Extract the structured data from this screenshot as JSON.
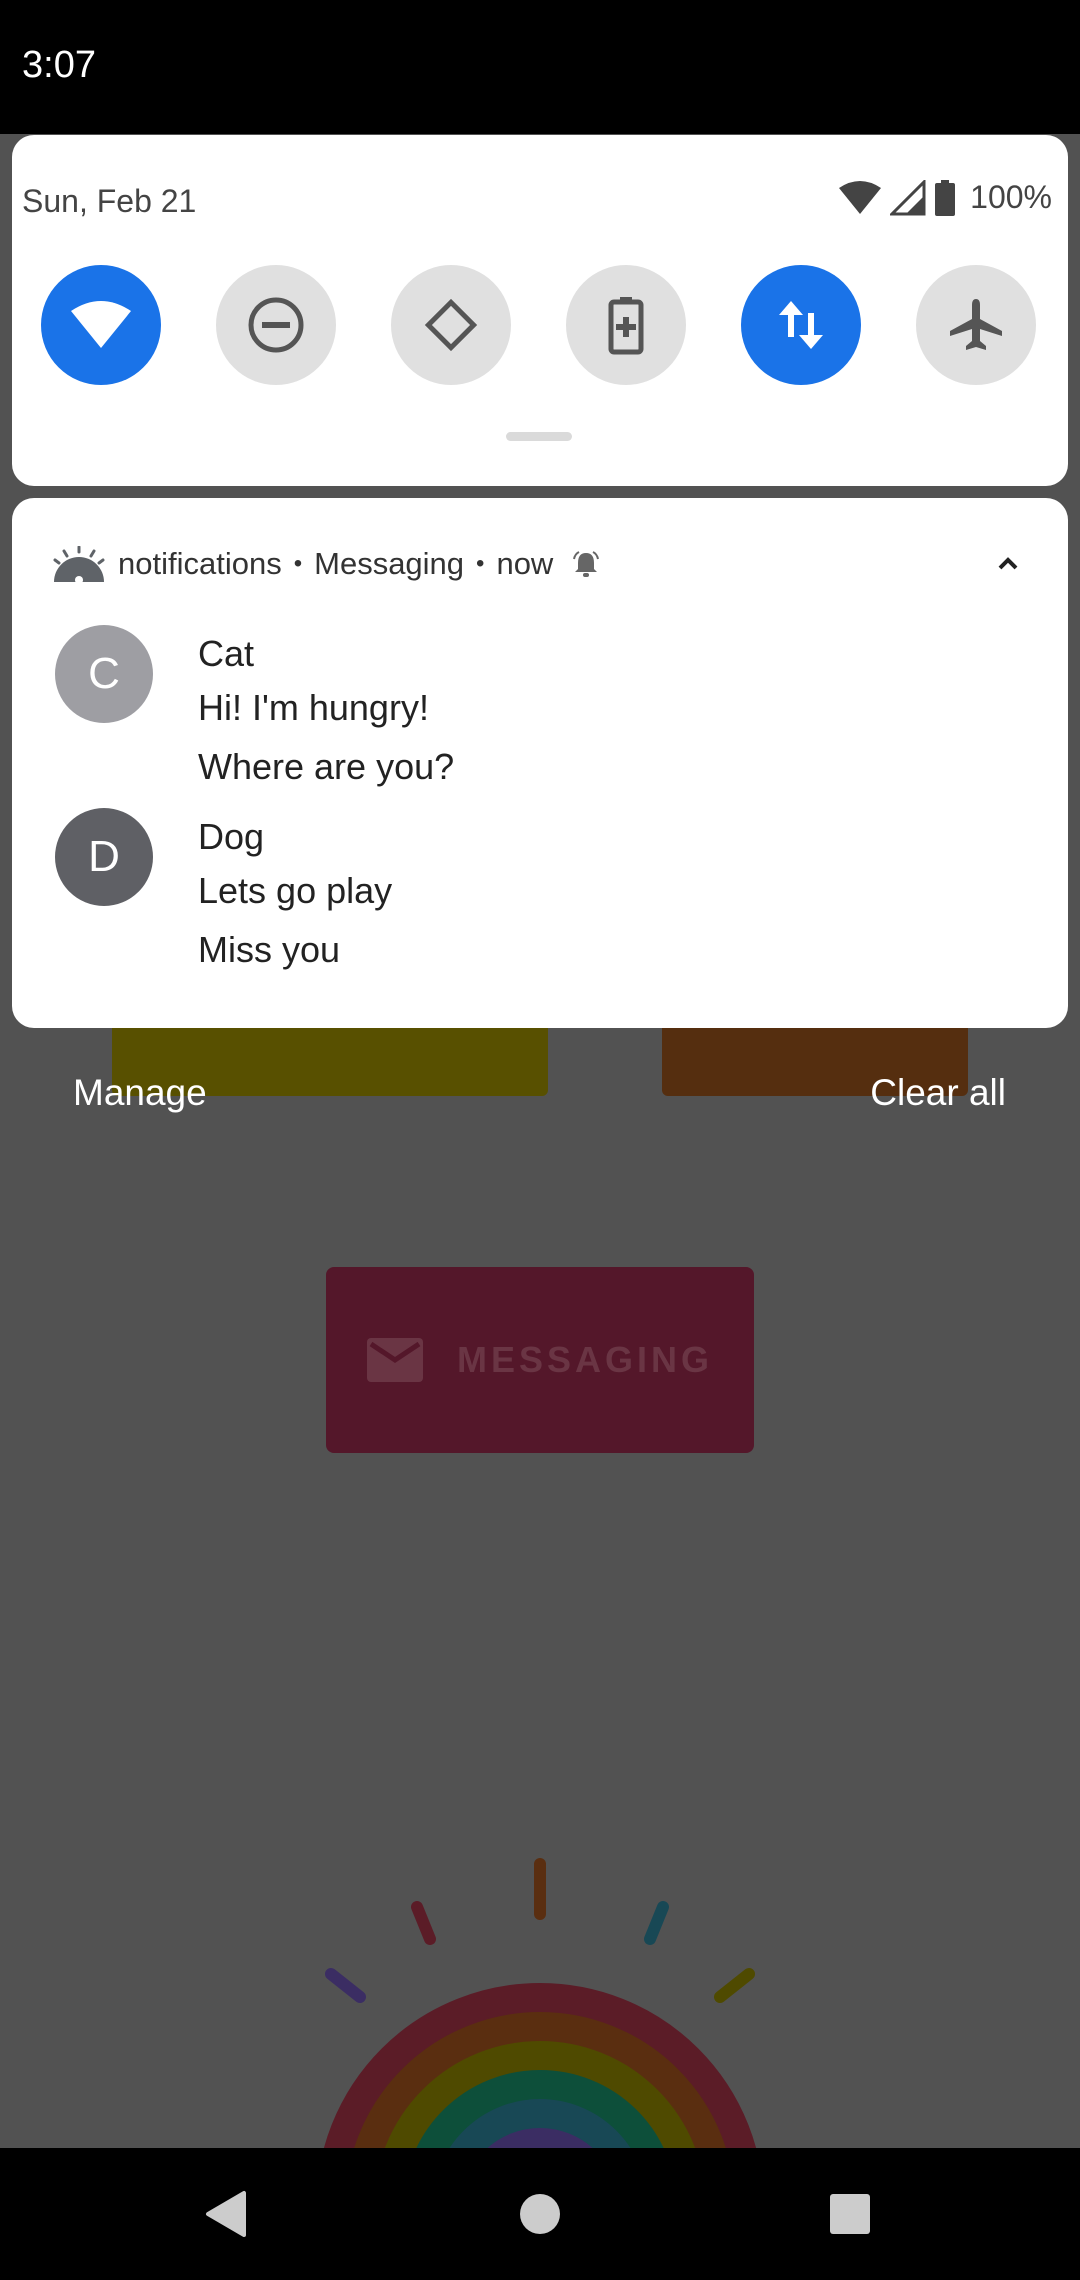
{
  "status_bar": {
    "time": "3:07"
  },
  "quick_settings": {
    "date": "Sun, Feb 21",
    "battery_percent": "100%",
    "tiles": [
      {
        "name": "wifi",
        "icon": "wifi-icon",
        "active": true
      },
      {
        "name": "do-not-disturb",
        "icon": "do-not-disturb-icon",
        "active": false
      },
      {
        "name": "auto-rotate",
        "icon": "auto-rotate-icon",
        "active": false
      },
      {
        "name": "battery-saver",
        "icon": "battery-saver-icon",
        "active": false
      },
      {
        "name": "mobile-data",
        "icon": "data-transfer-icon",
        "active": true
      },
      {
        "name": "airplane-mode",
        "icon": "airplane-icon",
        "active": false
      }
    ],
    "accent_color": "#1a73e8"
  },
  "notification": {
    "channel": "notifications",
    "app": "Messaging",
    "time": "now",
    "separator": "•",
    "messages": [
      {
        "initial": "C",
        "sender": "Cat",
        "lines": [
          "Hi! I'm hungry!",
          "Where are you?"
        ],
        "avatar_color": "#9e9ea3"
      },
      {
        "initial": "D",
        "sender": "Dog",
        "lines": [
          "Lets go play",
          "Miss you"
        ],
        "avatar_color": "#5f6065"
      }
    ]
  },
  "shade_actions": {
    "manage": "Manage",
    "clear_all": "Clear all"
  },
  "background_app": {
    "messaging_button": "MESSAGING"
  }
}
